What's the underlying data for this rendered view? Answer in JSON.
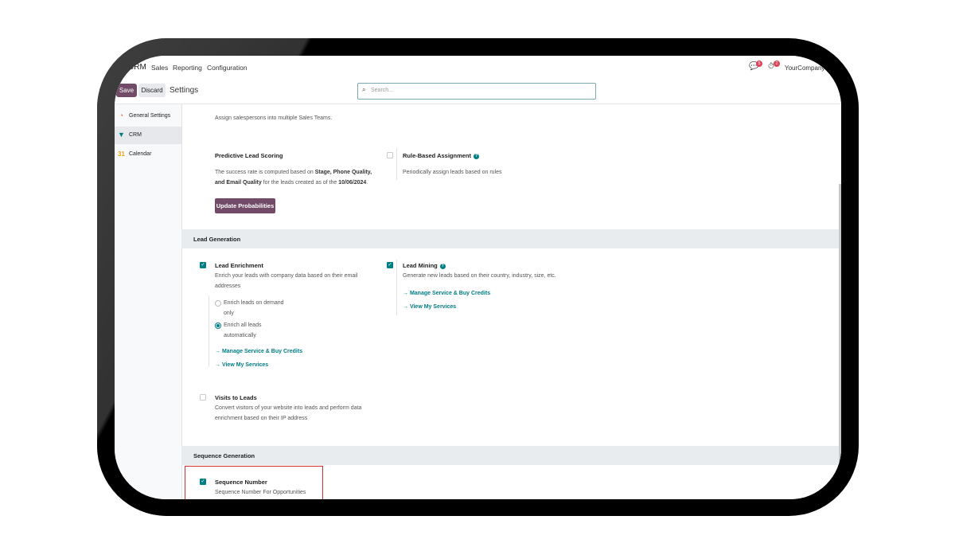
{
  "navbar": {
    "app": "CRM",
    "menu": [
      "Sales",
      "Reporting",
      "Configuration"
    ],
    "messages_count": "5",
    "activities_count": "2",
    "company": "YourCompany"
  },
  "control_panel": {
    "save": "Save",
    "discard": "Discard",
    "title": "Settings",
    "search_placeholder": "Search..."
  },
  "sidebar": {
    "items": [
      {
        "label": "General Settings",
        "icon": "odoo-icon",
        "color": "#e46f1d"
      },
      {
        "label": "CRM",
        "icon": "crm-icon",
        "color": "#017e84"
      },
      {
        "label": "Calendar",
        "icon": "calendar-icon",
        "color": "#e8a317"
      }
    ]
  },
  "content": {
    "sales_teams_desc": "Assign salespersons into multiple Sales Teams.",
    "predictive": {
      "title": "Predictive Lead Scoring",
      "desc_1": "The success rate is computed based on ",
      "desc_bold_1": "Stage, Phone Quality,",
      "desc_bold_2": "and Email Quality",
      "desc_2": " for the leads created as of the ",
      "desc_date": "10/06/2024",
      "desc_end": ".",
      "button": "Update Probabilities"
    },
    "rule_based": {
      "title": "Rule-Based Assignment",
      "desc": "Periodically assign leads based on rules",
      "checked": false
    },
    "lead_generation": {
      "header": "Lead Generation",
      "enrichment": {
        "title": "Lead Enrichment",
        "desc_1": "Enrich your leads with company data based on their email",
        "desc_2": "addresses",
        "checked": true,
        "options": [
          {
            "line1": "Enrich leads on demand",
            "line2": "only",
            "selected": false
          },
          {
            "line1": "Enrich all leads",
            "line2": "automatically",
            "selected": true
          }
        ],
        "link_1": "→ Manage Service & Buy Credits",
        "link_2": "→ View My Services"
      },
      "mining": {
        "title": "Lead Mining",
        "desc": "Generate new leads based on their country, industry, size, etc.",
        "checked": true,
        "link_1": "→ Manage Service & Buy Credits",
        "link_2": "→ View My Services"
      },
      "visits": {
        "title": "Visits to Leads",
        "desc_1": "Convert visitors of your website into leads and perform data",
        "desc_2": "enrichment based on their IP address",
        "checked": false
      }
    },
    "sequence_generation": {
      "header": "Sequence Generation",
      "number": {
        "title": "Sequence Number",
        "desc": "Sequence Number For Opportunities",
        "checked": true
      }
    }
  },
  "colors": {
    "primary": "#714b67",
    "accent": "#017e84",
    "highlight_border": "#d32f2f"
  }
}
